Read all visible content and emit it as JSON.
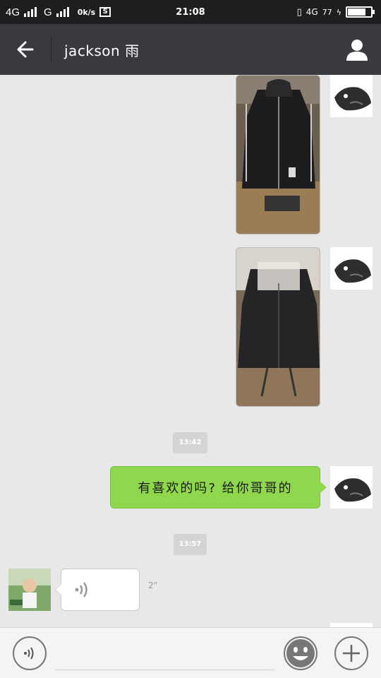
{
  "status_bar": {
    "network_1": "4G",
    "network_2": "G",
    "speed": "0k/s",
    "s_icon": "S",
    "time": "21:08",
    "right_net": "4G",
    "battery": "77"
  },
  "header": {
    "title": "jackson 雨"
  },
  "messages": {
    "time_1": "13:42",
    "text_1": "有喜欢的吗? 给你哥哥的",
    "time_2": "13:57",
    "voice_duration": "2\""
  },
  "icons": {
    "back": "arrow-left-icon",
    "profile": "person-icon",
    "voice": "voice-icon",
    "emoji": "smiley-icon",
    "plus": "plus-icon"
  },
  "colors": {
    "header_bg": "#393a3f",
    "status_bg": "#1e1e1e",
    "chat_bg": "#e8e8e8",
    "green_bubble": "#8fd84e"
  },
  "battery_level": 0.77
}
